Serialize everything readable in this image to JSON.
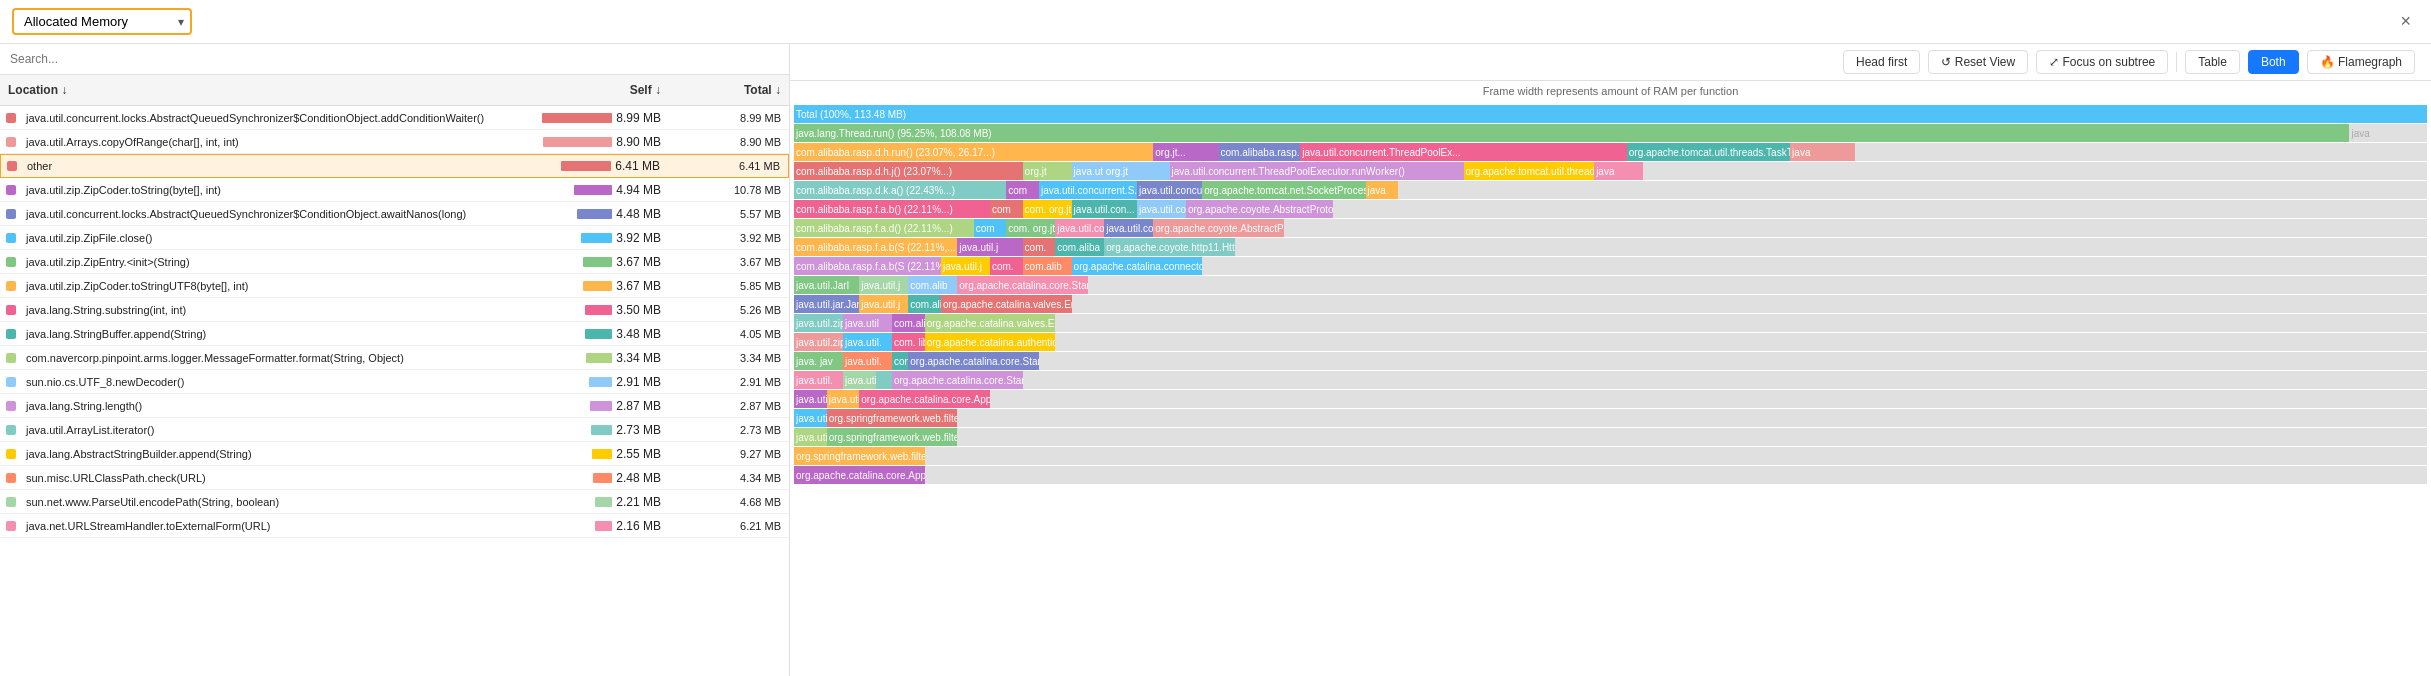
{
  "header": {
    "dropdown_label": "Allocated Memory",
    "close_label": "×"
  },
  "search": {
    "placeholder": "Search..."
  },
  "table": {
    "columns": {
      "location": "Location ↓",
      "self": "Self ↓",
      "total": "Total ↓"
    },
    "rows": [
      {
        "color": "#e57373",
        "location": "java.util.concurrent.locks.AbstractQueuedSynchronizer$ConditionObject.addConditionWaiter()",
        "self": "8.99 MB",
        "selfPct": 100,
        "total": "8.99 MB",
        "selfColor": "#e57373",
        "highlighted": false
      },
      {
        "color": "#ef9a9a",
        "location": "java.util.Arrays.copyOfRange(char[], int, int)",
        "self": "8.90 MB",
        "selfPct": 99,
        "total": "8.90 MB",
        "selfColor": "#ef9a9a",
        "highlighted": false
      },
      {
        "color": "#e57373",
        "location": "other",
        "self": "6.41 MB",
        "selfPct": 71,
        "total": "6.41 MB",
        "selfColor": "#e57373",
        "highlighted": true
      },
      {
        "color": "#ba68c8",
        "location": "java.util.zip.ZipCoder.toString(byte[], int)",
        "self": "4.94 MB",
        "selfPct": 55,
        "total": "10.78 MB",
        "selfColor": "#ba68c8",
        "highlighted": false
      },
      {
        "color": "#7986cb",
        "location": "java.util.concurrent.locks.AbstractQueuedSynchronizer$ConditionObject.awaitNanos(long)",
        "self": "4.48 MB",
        "selfPct": 50,
        "total": "5.57 MB",
        "selfColor": "#7986cb",
        "highlighted": false
      },
      {
        "color": "#4fc3f7",
        "location": "java.util.zip.ZipFile.close()",
        "self": "3.92 MB",
        "selfPct": 44,
        "total": "3.92 MB",
        "selfColor": "#4fc3f7",
        "highlighted": false
      },
      {
        "color": "#81c784",
        "location": "java.util.zip.ZipEntry.<init>(String)",
        "self": "3.67 MB",
        "selfPct": 41,
        "total": "3.67 MB",
        "selfColor": "#81c784",
        "highlighted": false
      },
      {
        "color": "#ffb74d",
        "location": "java.util.zip.ZipCoder.toStringUTF8(byte[], int)",
        "self": "3.67 MB",
        "selfPct": 41,
        "total": "5.85 MB",
        "selfColor": "#ffb74d",
        "highlighted": false
      },
      {
        "color": "#f06292",
        "location": "java.lang.String.substring(int, int)",
        "self": "3.50 MB",
        "selfPct": 39,
        "total": "5.26 MB",
        "selfColor": "#f06292",
        "highlighted": false
      },
      {
        "color": "#4db6ac",
        "location": "java.lang.StringBuffer.append(String)",
        "self": "3.48 MB",
        "selfPct": 39,
        "total": "4.05 MB",
        "selfColor": "#4db6ac",
        "highlighted": false
      },
      {
        "color": "#aed581",
        "location": "com.navercorp.pinpoint.arms.logger.MessageFormatter.format(String, Object)",
        "self": "3.34 MB",
        "selfPct": 37,
        "total": "3.34 MB",
        "selfColor": "#aed581",
        "highlighted": false
      },
      {
        "color": "#90caf9",
        "location": "sun.nio.cs.UTF_8.newDecoder()",
        "self": "2.91 MB",
        "selfPct": 32,
        "total": "2.91 MB",
        "selfColor": "#90caf9",
        "highlighted": false
      },
      {
        "color": "#ce93d8",
        "location": "java.lang.String.length()",
        "self": "2.87 MB",
        "selfPct": 32,
        "total": "2.87 MB",
        "selfColor": "#ce93d8",
        "highlighted": false
      },
      {
        "color": "#80cbc4",
        "location": "java.util.ArrayList.iterator()",
        "self": "2.73 MB",
        "selfPct": 30,
        "total": "2.73 MB",
        "selfColor": "#80cbc4",
        "highlighted": false
      },
      {
        "color": "#ffcc02",
        "location": "java.lang.AbstractStringBuilder.append(String)",
        "self": "2.55 MB",
        "selfPct": 28,
        "total": "9.27 MB",
        "selfColor": "#ffcc02",
        "highlighted": false
      },
      {
        "color": "#ff8a65",
        "location": "sun.misc.URLClassPath.check(URL)",
        "self": "2.48 MB",
        "selfPct": 28,
        "total": "4.34 MB",
        "selfColor": "#ff8a65",
        "highlighted": false
      },
      {
        "color": "#a5d6a7",
        "location": "sun.net.www.ParseUtil.encodePath(String, boolean)",
        "self": "2.21 MB",
        "selfPct": 25,
        "total": "4.68 MB",
        "selfColor": "#a5d6a7",
        "highlighted": false
      },
      {
        "color": "#f48fb1",
        "location": "java.net.URLStreamHandler.toExternalForm(URL)",
        "self": "2.16 MB",
        "selfPct": 24,
        "total": "6.21 MB",
        "selfColor": "#f48fb1",
        "highlighted": false
      }
    ]
  },
  "toolbar": {
    "head_first_label": "Head first",
    "reset_view_label": "↺ Reset View",
    "focus_subtree_label": "⤢ Focus on subtree",
    "table_label": "Table",
    "both_label": "Both",
    "flamegraph_label": "🔥 Flamegraph"
  },
  "flame": {
    "title": "Frame width represents amount of RAM per function",
    "total_label": "Total (100%, 113.48 MB)",
    "java_thread_label": "java.lang.Thread.run() (95.25%, 108.08 MB)"
  }
}
